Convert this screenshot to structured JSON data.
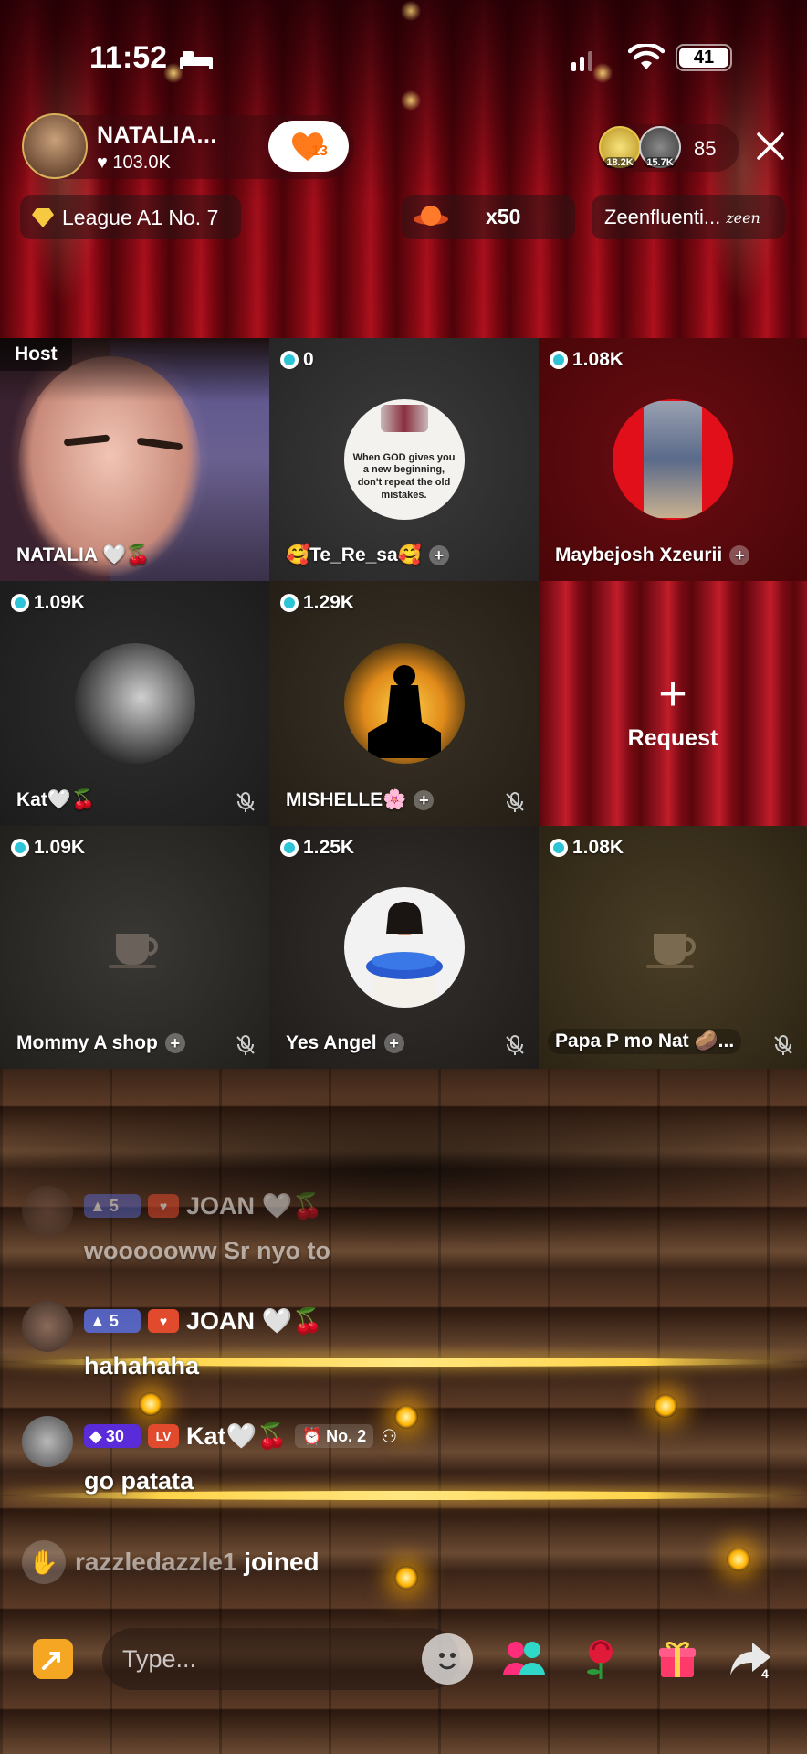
{
  "status_bar": {
    "time": "11:52",
    "battery": "41"
  },
  "host": {
    "name": "NATALIA...",
    "likes": "♥ 103.0K",
    "heart_count": "13"
  },
  "viewers": {
    "badge_1": "18.2K",
    "badge_2": "15.7K",
    "count": "85"
  },
  "league": {
    "label": "League A1 No. 7"
  },
  "gift": {
    "count": "x50"
  },
  "zeen": {
    "label": "Zeenfluenti...",
    "logo": "zeen"
  },
  "grid": {
    "cells": [
      {
        "badge": "Host",
        "label": "NATALIA 🤍🍒"
      },
      {
        "score": "0",
        "label": "🥰Te_Re_sa🥰",
        "quote": "When GOD gives you a new beginning, don't repeat the old mistakes."
      },
      {
        "score": "1.08K",
        "label": "Maybejosh Xzeurii"
      },
      {
        "score": "1.09K",
        "label": "Kat🤍🍒"
      },
      {
        "score": "1.29K",
        "label": "MISHELLE🌸"
      },
      {
        "request_label": "Request"
      },
      {
        "score": "1.09K",
        "label": "Mommy A shop"
      },
      {
        "score": "1.25K",
        "label": "Yes Angel"
      },
      {
        "score": "1.08K",
        "label": "Papa P mo Nat 🥔..."
      }
    ]
  },
  "chat": [
    {
      "level": "5",
      "user": "JOAN 🤍🍒",
      "message": "woooooww Sr nyo to"
    },
    {
      "level": "5",
      "user": "JOAN 🤍🍒",
      "message": "hahahaha"
    },
    {
      "level": "30",
      "user": "Kat🤍🍒",
      "rank": "No. 2",
      "message": "go patata"
    }
  ],
  "joined": {
    "user": "razzledazzle1",
    "text": " joined"
  },
  "bottom_bar": {
    "placeholder": "Type...",
    "share_count": "4"
  },
  "colors": {
    "curtain": "#8a0a14",
    "accent_orange": "#f5a623",
    "score_dot": "#2ec4d8",
    "level_badge": "#5a6edc"
  }
}
